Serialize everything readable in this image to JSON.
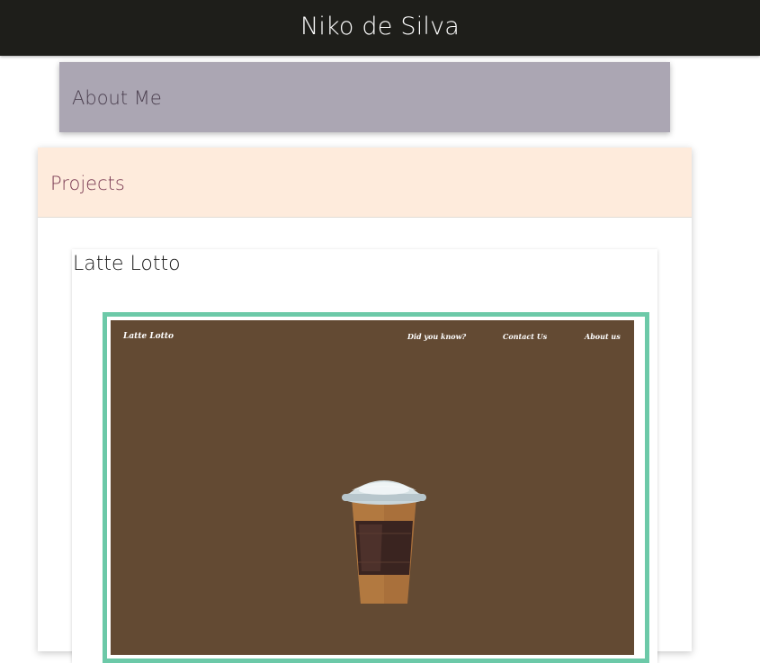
{
  "header": {
    "title": "Niko de Silva"
  },
  "sections": {
    "about": {
      "label": "About Me"
    },
    "projects": {
      "label": "Projects"
    }
  },
  "project": {
    "title": "Latte Lotto",
    "preview": {
      "logo": "Latte Lotto",
      "nav": [
        "Did you know?",
        "Contact Us",
        "About us"
      ],
      "image": "coffee-cup-icon"
    }
  },
  "colors": {
    "topbar": "#1e1e1a",
    "about_bg": "#aba6b3",
    "projects_header_bg": "#feebdc",
    "projects_label": "#7a3a52",
    "frame_accent": "#6cc9a8",
    "preview_bg": "#634a33"
  }
}
